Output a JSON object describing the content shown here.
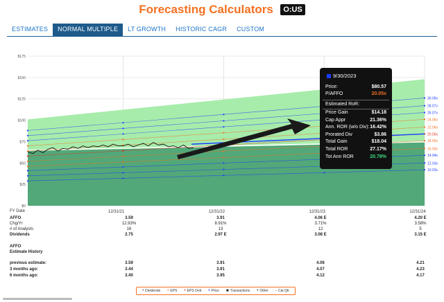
{
  "app": {
    "title": "Forecasting Calculators",
    "ticker": "O:US"
  },
  "tabs": [
    {
      "label": "ESTIMATES",
      "active": false
    },
    {
      "label": "NORMAL MULTIPLE",
      "active": true
    },
    {
      "label": "LT GROWTH",
      "active": false
    },
    {
      "label": "HISTORIC CAGR",
      "active": false
    },
    {
      "label": "CUSTOM",
      "active": false
    }
  ],
  "colors": {
    "accent": "#f37021",
    "tab_active": "#1e5a8a",
    "price_line": "#1a3cff",
    "tooltip_bg": "#111111"
  },
  "chart_data": {
    "type": "area",
    "y_ticks": [
      "$175",
      "$150",
      "$125",
      "$100",
      "$75",
      "$50",
      "$25",
      "$0"
    ],
    "y_tick_values": [
      175,
      150,
      125,
      100,
      75,
      50,
      25,
      0
    ],
    "ylim": [
      0,
      175
    ],
    "x_ticks": [
      "12/31/21",
      "12/31/22",
      "12/31/23",
      "12/31/24"
    ],
    "x_tick_years": [
      2022.0,
      2023.0,
      2024.0,
      2025.0
    ],
    "xlim": [
      2021.05,
      2025.0
    ],
    "green_band_top": [
      [
        2021.05,
        101
      ],
      [
        2025.0,
        148
      ]
    ],
    "dark_band_top": [
      [
        2021.05,
        64
      ],
      [
        2025.0,
        74
      ]
    ],
    "multiple_lines": [
      {
        "label": "30.09x",
        "color": "#1a3cff",
        "start": 88,
        "end": 126
      },
      {
        "label": "28.07x",
        "color": "#1a3cff",
        "start": 82,
        "end": 117
      },
      {
        "label": "26.07x",
        "color": "#1a3cff",
        "start": 76,
        "end": 109
      },
      {
        "label": "24.06x",
        "color": "#f37021",
        "start": 70,
        "end": 101
      },
      {
        "label": "22.06x",
        "color": "#f37021",
        "start": 64,
        "end": 92
      },
      {
        "label": "20.05x",
        "color": "#e03020",
        "start": 58,
        "end": 84
      },
      {
        "label": "18.05x",
        "color": "#f37021",
        "start": 52,
        "end": 76
      },
      {
        "label": "16.04x",
        "color": "#f37021",
        "start": 46,
        "end": 67
      },
      {
        "label": "14.04x",
        "color": "#1a3cff",
        "start": 41,
        "end": 59
      },
      {
        "label": "12.03x",
        "color": "#1a3cff",
        "start": 35,
        "end": 50
      },
      {
        "label": "10.03x",
        "color": "#1a3cff",
        "start": 29,
        "end": 42
      }
    ],
    "price_series": [
      [
        2021.05,
        63
      ],
      [
        2021.1,
        61
      ],
      [
        2021.15,
        65
      ],
      [
        2021.2,
        62
      ],
      [
        2021.25,
        66
      ],
      [
        2021.3,
        68
      ],
      [
        2021.35,
        64
      ],
      [
        2021.4,
        67
      ],
      [
        2021.45,
        66
      ],
      [
        2021.5,
        69
      ],
      [
        2021.55,
        67
      ],
      [
        2021.6,
        70
      ],
      [
        2021.65,
        68
      ],
      [
        2021.7,
        70
      ],
      [
        2021.75,
        69
      ],
      [
        2021.8,
        71
      ],
      [
        2021.85,
        69
      ],
      [
        2021.9,
        72
      ],
      [
        2021.95,
        70
      ],
      [
        2022.0,
        70
      ],
      [
        2022.05,
        72
      ],
      [
        2022.1,
        69
      ],
      [
        2022.15,
        71
      ],
      [
        2022.2,
        73
      ],
      [
        2022.25,
        70
      ],
      [
        2022.3,
        74
      ],
      [
        2022.35,
        71
      ],
      [
        2022.4,
        72
      ],
      [
        2022.45,
        69
      ],
      [
        2022.5,
        70
      ],
      [
        2022.55,
        68
      ],
      [
        2022.6,
        71
      ],
      [
        2022.65,
        67
      ],
      [
        2022.7,
        68
      ]
    ]
  },
  "tooltip": {
    "date": "9/30/2023",
    "price_label": "Price:",
    "price": "$80.57",
    "pafo_label": "P/AFFO",
    "pafo": "20.05x",
    "est_title": "Estimated RoR:",
    "rows": [
      {
        "label": "Price Gain",
        "value": "$14.18"
      },
      {
        "label": "Cap Appr",
        "value": "21.36%"
      },
      {
        "label": "Ann. ROR (w/o Div):",
        "value": "16.42%"
      },
      {
        "label": "Prorated Div",
        "value": "$3.86"
      },
      {
        "label": "Total Gain",
        "value": "$18.04"
      },
      {
        "label": "Total ROR",
        "value": "27.17%"
      },
      {
        "label": "Tot Ann ROR",
        "value": "20.78%",
        "highlight": "#3ddc84"
      }
    ]
  },
  "table": {
    "fy_label": "FY Date",
    "rows": [
      {
        "label": "AFFO",
        "bold": true,
        "values": [
          "3.59",
          "3.91",
          "4.06 E",
          "4.20 E"
        ]
      },
      {
        "label": "Chg/Yr",
        "bold": false,
        "values": [
          "12.93%",
          "8.91%",
          "3.71%",
          "3.58%"
        ]
      },
      {
        "label": "# of Analysts",
        "bold": false,
        "values": [
          "16",
          "13",
          "12",
          "5"
        ]
      },
      {
        "label": "Dividends",
        "bold": true,
        "values": [
          "2.75",
          "2.97 E",
          "3.08 E",
          "3.15 E"
        ]
      },
      {
        "label": "AFFO",
        "bold": true,
        "values": [
          "",
          "",
          "",
          ""
        ]
      },
      {
        "label": "Estimate History",
        "bold": true,
        "values": [
          "",
          "",
          "",
          ""
        ]
      },
      {
        "label": "previous estimate:",
        "bold": true,
        "values": [
          "3.59",
          "3.91",
          "4.06",
          "4.21"
        ]
      },
      {
        "label": "3 months ago:",
        "bold": true,
        "values": [
          "3.44",
          "3.91",
          "4.07",
          "4.23"
        ]
      },
      {
        "label": "6 months ago:",
        "bold": true,
        "values": [
          "3.40",
          "3.95",
          "4.12",
          "4.17"
        ]
      }
    ]
  },
  "legend": [
    {
      "label": "Dividends",
      "symbol": "•",
      "color": "#555"
    },
    {
      "label": "EPS",
      "symbol": "•",
      "color": "#f37021"
    },
    {
      "label": "EPS Ovd",
      "symbol": "•",
      "color": "#e03020"
    },
    {
      "label": "Price",
      "symbol": "•",
      "color": "#1a3cff"
    },
    {
      "label": "Transactions",
      "symbol": "■",
      "color": "#111"
    },
    {
      "label": "Other",
      "symbol": "•",
      "color": "#333"
    },
    {
      "label": "Cal Qtr",
      "symbol": "-",
      "color": "#333"
    }
  ]
}
